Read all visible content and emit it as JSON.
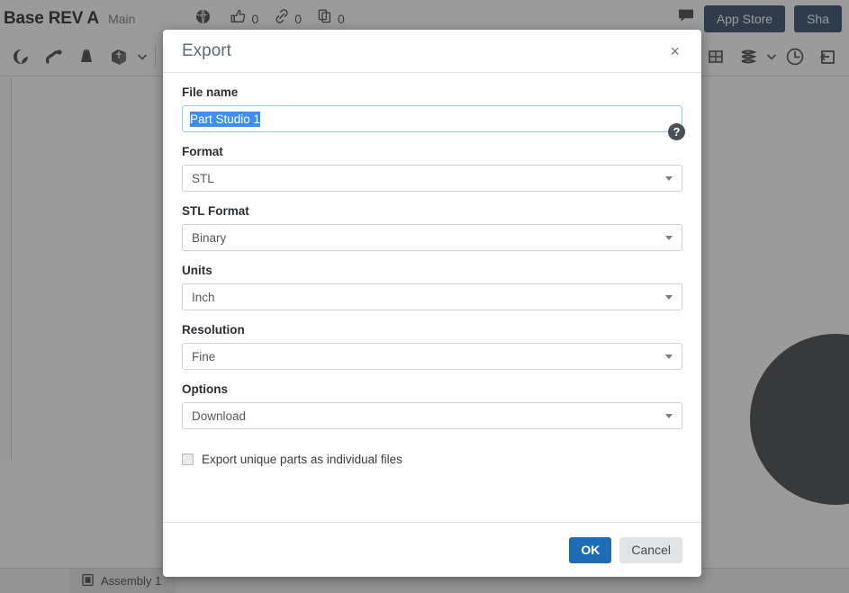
{
  "app": {
    "document_title": "Base REV A",
    "branch": "Main",
    "stats": [
      {
        "icon": "globe-icon",
        "count": ""
      },
      {
        "icon": "thumbs-up-icon",
        "count": "0"
      },
      {
        "icon": "link-icon",
        "count": "0"
      },
      {
        "icon": "copy-icon",
        "count": "0"
      }
    ],
    "comment_icon": "comment-bubble-icon",
    "buttons": [
      {
        "label": "App Store"
      },
      {
        "label": "Sha"
      }
    ],
    "toolbar_left_icons": [
      "shell-icon",
      "sweep-icon",
      "draft-icon",
      "transform-icon",
      "transform-chevron-icon"
    ],
    "toolbar_right_icons": [
      "split-chevron-icon",
      "plane-icon",
      "helix-icon",
      "helix-chevron-icon",
      "clock-icon",
      "import-export-icon"
    ],
    "tabs": [
      {
        "label": "Assembly 1",
        "icon": "assembly-document-icon"
      }
    ]
  },
  "dialog": {
    "title": "Export",
    "close_label": "×",
    "help_label": "?",
    "fields": [
      {
        "label": "File name",
        "type": "text",
        "value": "Part Studio 1",
        "selected": true
      },
      {
        "label": "Format",
        "type": "select",
        "value": "STL"
      },
      {
        "label": "STL Format",
        "type": "select",
        "value": "Binary"
      },
      {
        "label": "Units",
        "type": "select",
        "value": "Inch"
      },
      {
        "label": "Resolution",
        "type": "select",
        "value": "Fine"
      },
      {
        "label": "Options",
        "type": "select",
        "value": "Download"
      }
    ],
    "checkbox": {
      "label": "Export unique parts as individual files",
      "checked": false
    },
    "footer": {
      "ok_label": "OK",
      "cancel_label": "Cancel"
    }
  },
  "colors": {
    "primary_button": "#1e6cb3",
    "secondary_button": "#e2e3e4",
    "selection_highlight": "#3d8ef2",
    "focus_border": "#8ecbee",
    "nav_button": "#1e3a5f",
    "dialog_title": "#5c6b7a"
  }
}
